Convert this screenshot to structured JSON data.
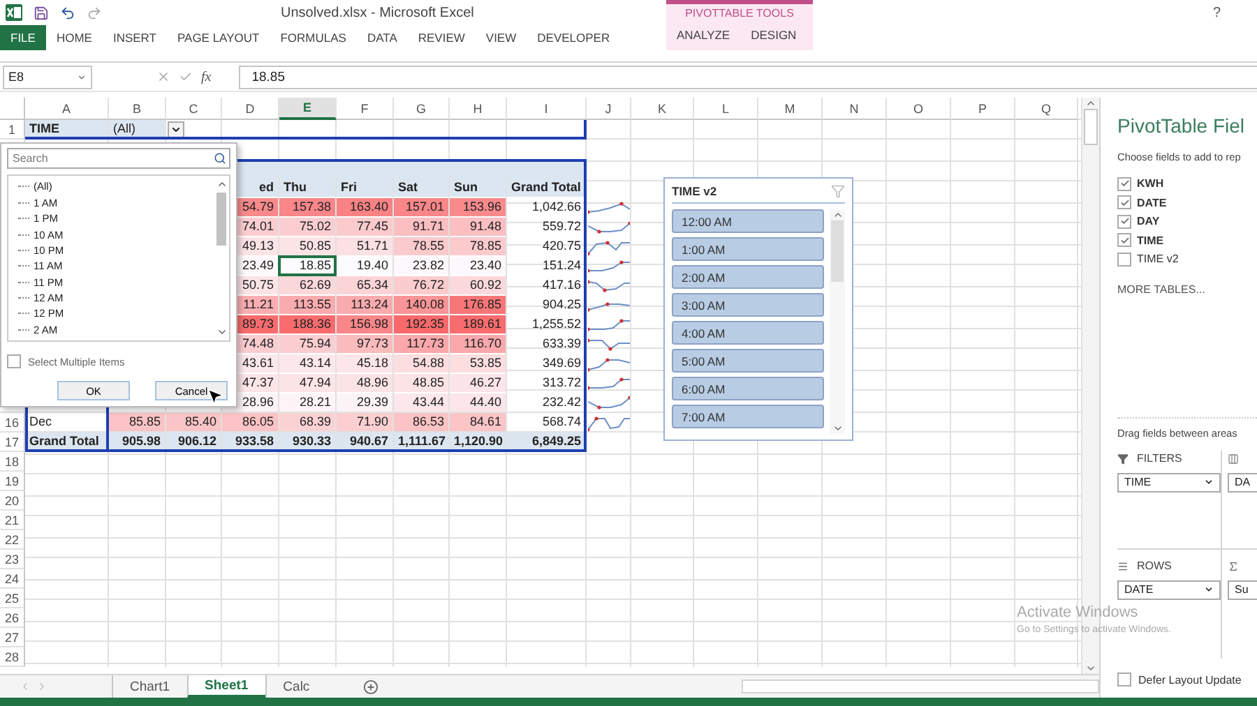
{
  "window": {
    "title": "Unsolved.xlsx - Microsoft Excel",
    "help": "?"
  },
  "ribbon": {
    "tabs": [
      {
        "label": "FILE",
        "selected": true
      },
      {
        "label": "HOME",
        "selected": false
      },
      {
        "label": "INSERT",
        "selected": false
      },
      {
        "label": "PAGE LAYOUT",
        "selected": false
      },
      {
        "label": "FORMULAS",
        "selected": false
      },
      {
        "label": "DATA",
        "selected": false
      },
      {
        "label": "REVIEW",
        "selected": false
      },
      {
        "label": "VIEW",
        "selected": false
      },
      {
        "label": "DEVELOPER",
        "selected": false
      }
    ],
    "context_group": {
      "label": "PIVOTTABLE TOOLS",
      "tabs": [
        {
          "label": "ANALYZE",
          "selected": false
        },
        {
          "label": "DESIGN",
          "selected": false
        }
      ]
    }
  },
  "formula_bar": {
    "name_box": "E8",
    "function_label": "fx",
    "value": "18.85"
  },
  "sheet": {
    "columns": [
      {
        "label": "A",
        "selected": false
      },
      {
        "label": "B",
        "selected": false
      },
      {
        "label": "C",
        "selected": false
      },
      {
        "label": "D",
        "selected": false
      },
      {
        "label": "E",
        "selected": true
      },
      {
        "label": "F",
        "selected": false
      },
      {
        "label": "G",
        "selected": false
      },
      {
        "label": "H",
        "selected": false
      },
      {
        "label": "I",
        "selected": false
      },
      {
        "label": "J",
        "selected": false
      },
      {
        "label": "K",
        "selected": false
      },
      {
        "label": "L",
        "selected": false
      },
      {
        "label": "M",
        "selected": false
      },
      {
        "label": "N",
        "selected": false
      },
      {
        "label": "O",
        "selected": false
      },
      {
        "label": "P",
        "selected": false
      },
      {
        "label": "Q",
        "selected": false
      }
    ],
    "rows": [
      {
        "number": "1",
        "kind": "filter",
        "cells": [
          {
            "text": "TIME"
          },
          {
            "text": "(All)",
            "dropdown": true
          }
        ]
      },
      {
        "kind": "blank"
      },
      {
        "kind": "band"
      },
      {
        "kind": "header",
        "cells": [
          null,
          null,
          null,
          {
            "text": "ed"
          },
          {
            "text": "Thu"
          },
          {
            "text": "Fri"
          },
          {
            "text": "Sat"
          },
          {
            "text": "Sun"
          },
          {
            "text": "Grand Total"
          }
        ]
      },
      {
        "kind": "data",
        "sparkline": true,
        "cells": [
          null,
          null,
          null,
          {
            "text": "54.79",
            "color": "#f98a8c"
          },
          {
            "text": "157.38",
            "color": "#f98689"
          },
          {
            "text": "163.40",
            "color": "#f98284"
          },
          {
            "text": "157.01",
            "color": "#f98689"
          },
          {
            "text": "153.96",
            "color": "#f98a8c"
          },
          {
            "text": "1,042.66"
          }
        ]
      },
      {
        "kind": "data",
        "sparkline": true,
        "cells": [
          null,
          null,
          null,
          {
            "text": "74.01",
            "color": "#fbcdd0"
          },
          {
            "text": "75.02",
            "color": "#fbcdd0"
          },
          {
            "text": "77.45",
            "color": "#fbcacd"
          },
          {
            "text": "91.71",
            "color": "#fbbec1"
          },
          {
            "text": "91.48",
            "color": "#fbbec1"
          },
          {
            "text": "559.72"
          }
        ]
      },
      {
        "kind": "data",
        "sparkline": true,
        "cells": [
          null,
          null,
          null,
          {
            "text": "49.13",
            "color": "#fce3e6"
          },
          {
            "text": "50.85",
            "color": "#fce3e6"
          },
          {
            "text": "51.71",
            "color": "#fce0e3"
          },
          {
            "text": "78.55",
            "color": "#fbcacd"
          },
          {
            "text": "78.85",
            "color": "#fbcacd"
          },
          {
            "text": "420.75"
          }
        ]
      },
      {
        "kind": "data",
        "sparkline": true,
        "cells": [
          null,
          null,
          null,
          {
            "text": "23.49",
            "color": "#fcf8fb"
          },
          {
            "text": "18.85",
            "color": "#fcfcff",
            "selected": true
          },
          {
            "text": "19.40",
            "color": "#fcfcff"
          },
          {
            "text": "23.82",
            "color": "#fcf8fb"
          },
          {
            "text": "23.40",
            "color": "#fcf8fb"
          },
          {
            "text": "151.24"
          }
        ]
      },
      {
        "kind": "data",
        "sparkline": true,
        "cells": [
          null,
          null,
          null,
          {
            "text": "50.75",
            "color": "#fce3e6"
          },
          {
            "text": "62.69",
            "color": "#fbd7da"
          },
          {
            "text": "65.34",
            "color": "#fbd4d7"
          },
          {
            "text": "76.72",
            "color": "#fbccce"
          },
          {
            "text": "60.92",
            "color": "#fbd8db"
          },
          {
            "text": "417.16"
          }
        ]
      },
      {
        "kind": "data",
        "sparkline": true,
        "cells": [
          null,
          null,
          null,
          {
            "text": "11.21",
            "color": "#faaeb1"
          },
          {
            "text": "113.55",
            "color": "#faabae"
          },
          {
            "text": "113.24",
            "color": "#faabae"
          },
          {
            "text": "140.08",
            "color": "#f99597"
          },
          {
            "text": "176.85",
            "color": "#f87678"
          },
          {
            "text": "904.25"
          }
        ]
      },
      {
        "kind": "data",
        "sparkline": true,
        "cells": [
          null,
          null,
          null,
          {
            "text": "89.73",
            "color": "#f86c6e"
          },
          {
            "text": "188.36",
            "color": "#f86c6e"
          },
          {
            "text": "156.98",
            "color": "#f98689"
          },
          {
            "text": "192.35",
            "color": "#f8696b"
          },
          {
            "text": "189.61",
            "color": "#f86c6e"
          },
          {
            "text": "1,255.52"
          }
        ]
      },
      {
        "kind": "data",
        "sparkline": true,
        "cells": [
          null,
          null,
          null,
          {
            "text": "74.48",
            "color": "#fbcdd0"
          },
          {
            "text": "75.94",
            "color": "#fbcdd0"
          },
          {
            "text": "97.73",
            "color": "#fabbbc"
          },
          {
            "text": "117.73",
            "color": "#faa8ab"
          },
          {
            "text": "116.70",
            "color": "#faa8ab"
          },
          {
            "text": "633.39"
          }
        ]
      },
      {
        "kind": "data",
        "sparkline": true,
        "cells": [
          null,
          null,
          null,
          {
            "text": "43.61",
            "color": "#fce7ea"
          },
          {
            "text": "43.14",
            "color": "#fce7ea"
          },
          {
            "text": "45.18",
            "color": "#fce6e9"
          },
          {
            "text": "54.88",
            "color": "#fcdde0"
          },
          {
            "text": "53.85",
            "color": "#fcdde0"
          },
          {
            "text": "349.69"
          }
        ]
      },
      {
        "kind": "data",
        "sparkline": true,
        "cells": [
          null,
          null,
          null,
          {
            "text": "47.37",
            "color": "#fce4e7"
          },
          {
            "text": "47.94",
            "color": "#fce4e7"
          },
          {
            "text": "48.96",
            "color": "#fce3e6"
          },
          {
            "text": "48.85",
            "color": "#fce3e6"
          },
          {
            "text": "46.27",
            "color": "#fce5e8"
          },
          {
            "text": "313.72"
          }
        ]
      },
      {
        "kind": "data",
        "sparkline": true,
        "cells": [
          null,
          null,
          null,
          {
            "text": "28.96",
            "color": "#fcf3f6"
          },
          {
            "text": "28.21",
            "color": "#fcf4f7"
          },
          {
            "text": "29.39",
            "color": "#fcf3f6"
          },
          {
            "text": "43.44",
            "color": "#fce7ea"
          },
          {
            "text": "44.40",
            "color": "#fce6e9"
          },
          {
            "text": "232.42"
          }
        ]
      },
      {
        "number": "16",
        "kind": "data",
        "sparkline": true,
        "cells": [
          {
            "text": "Dec"
          },
          {
            "text": "85.85",
            "color": "#fbc3c5"
          },
          {
            "text": "85.40",
            "color": "#fbc4c7"
          },
          {
            "text": "86.05",
            "color": "#fbc3c5"
          },
          {
            "text": "68.39",
            "color": "#fbd2d4"
          },
          {
            "text": "71.90",
            "color": "#fbcfd1"
          },
          {
            "text": "86.53",
            "color": "#fbc3c5"
          },
          {
            "text": "84.61",
            "color": "#fbc4c7"
          },
          {
            "text": "568.74"
          }
        ]
      },
      {
        "number": "17",
        "kind": "total",
        "cells": [
          {
            "text": "Grand Total"
          },
          {
            "text": "905.98"
          },
          {
            "text": "906.12"
          },
          {
            "text": "933.58"
          },
          {
            "text": "930.33"
          },
          {
            "text": "940.67"
          },
          {
            "text": "1,111.67"
          },
          {
            "text": "1,120.90"
          },
          {
            "text": "6,849.25"
          }
        ]
      },
      {
        "number": "18",
        "kind": "blank"
      },
      {
        "number": "19",
        "kind": "blank"
      },
      {
        "number": "20",
        "kind": "blank"
      },
      {
        "number": "21",
        "kind": "blank"
      },
      {
        "number": "22",
        "kind": "blank"
      },
      {
        "number": "23",
        "kind": "blank"
      },
      {
        "number": "24",
        "kind": "blank"
      },
      {
        "number": "25",
        "kind": "blank"
      },
      {
        "number": "26",
        "kind": "blank"
      },
      {
        "number": "27",
        "kind": "blank"
      },
      {
        "number": "28",
        "kind": "blank"
      }
    ]
  },
  "filter_dropdown": {
    "search": {
      "placeholder": "Search"
    },
    "items": [
      {
        "label": "(All)"
      },
      {
        "label": "1 AM"
      },
      {
        "label": "1 PM"
      },
      {
        "label": "10 AM"
      },
      {
        "label": "10 PM"
      },
      {
        "label": "11 AM"
      },
      {
        "label": "11 PM"
      },
      {
        "label": "12 AM"
      },
      {
        "label": "12 PM"
      },
      {
        "label": "2 AM"
      }
    ],
    "multi_select": {
      "label": "Select Multiple Items",
      "checked": false
    },
    "buttons": [
      "OK",
      "Cancel"
    ]
  },
  "slicer": {
    "title": "TIME v2",
    "clear_disabled": true,
    "items": [
      {
        "label": "12:00 AM",
        "selected": true
      },
      {
        "label": "1:00 AM",
        "selected": true
      },
      {
        "label": "2:00 AM",
        "selected": true
      },
      {
        "label": "3:00 AM",
        "selected": true
      },
      {
        "label": "4:00 AM",
        "selected": true
      },
      {
        "label": "5:00 AM",
        "selected": true
      },
      {
        "label": "6:00 AM",
        "selected": true
      },
      {
        "label": "7:00 AM",
        "selected": true
      }
    ]
  },
  "sheet_tabs": [
    {
      "label": "Chart1",
      "selected": false
    },
    {
      "label": "Sheet1",
      "selected": true
    },
    {
      "label": "Calc",
      "selected": false
    }
  ],
  "pivot_pane": {
    "title": "PivotTable Fiel",
    "subtitle": "Choose fields to add to rep",
    "fields": [
      {
        "label": "KWH",
        "checked": true
      },
      {
        "label": "DATE",
        "checked": true
      },
      {
        "label": "DAY",
        "checked": true
      },
      {
        "label": "TIME",
        "checked": true
      },
      {
        "label": "TIME v2",
        "checked": false
      }
    ],
    "more_tables": "MORE TABLES...",
    "drag_hint": "Drag fields between areas",
    "filters": {
      "label": "FILTERS",
      "field": "TIME"
    },
    "columns": {
      "field": "DA"
    },
    "rows": {
      "label": "ROWS",
      "field": "DATE"
    },
    "values": {
      "field": "Su"
    },
    "defer": {
      "label": "Defer Layout Update",
      "checked": false
    }
  },
  "activation_notice": {
    "title": "Activate Windows",
    "text": "Go to Settings to activate Windows."
  }
}
